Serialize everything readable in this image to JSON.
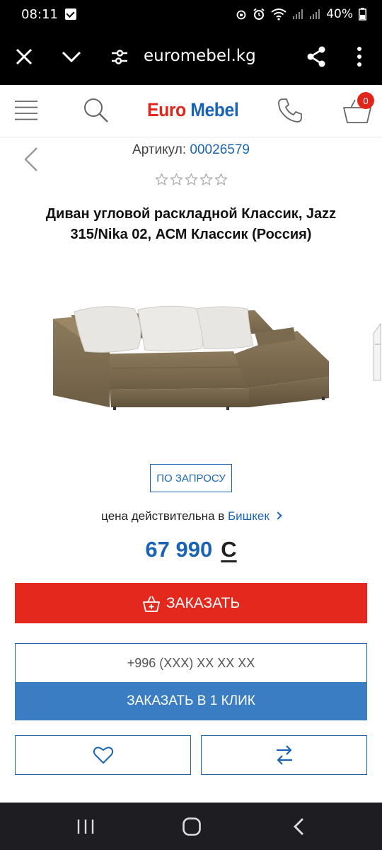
{
  "status_bar": {
    "time": "08:11",
    "battery": "40%"
  },
  "browser": {
    "url": "euromebel.kg"
  },
  "header": {
    "logo_part1": "Euro",
    "logo_part2": "Mebel",
    "cart_count": "0"
  },
  "product": {
    "sku_label": "Артикул:",
    "sku_value": "00026579",
    "rating_stars": 0,
    "rating_max": 5,
    "title": "Диван угловой раскладной Классик, Jazz 315/Nika 02, АСМ Классик (Россия)",
    "availability": "ПО ЗАПРОСУ",
    "price_valid_text": "цена действительна в",
    "city": "Бишкек",
    "price": "67 990",
    "currency": "С"
  },
  "actions": {
    "order_label": "ЗАКАЗАТЬ",
    "phone_placeholder": "+996 (XXX) XX XX XX",
    "one_click_label": "ЗАКАЗАТЬ В 1 КЛИК"
  },
  "colors": {
    "brand_red": "#e4281e",
    "brand_blue": "#1b64b4",
    "button_blue": "#3a7dc2"
  },
  "icons": [
    "close-icon",
    "chevron-down-icon",
    "site-settings-icon",
    "share-icon",
    "more-vert-icon",
    "menu-icon",
    "search-icon",
    "phone-icon",
    "cart-icon",
    "back-arrow-icon",
    "star-icon",
    "basket-icon",
    "heart-icon",
    "compare-icon",
    "nav-recent-icon",
    "nav-home-icon",
    "nav-back-icon"
  ]
}
